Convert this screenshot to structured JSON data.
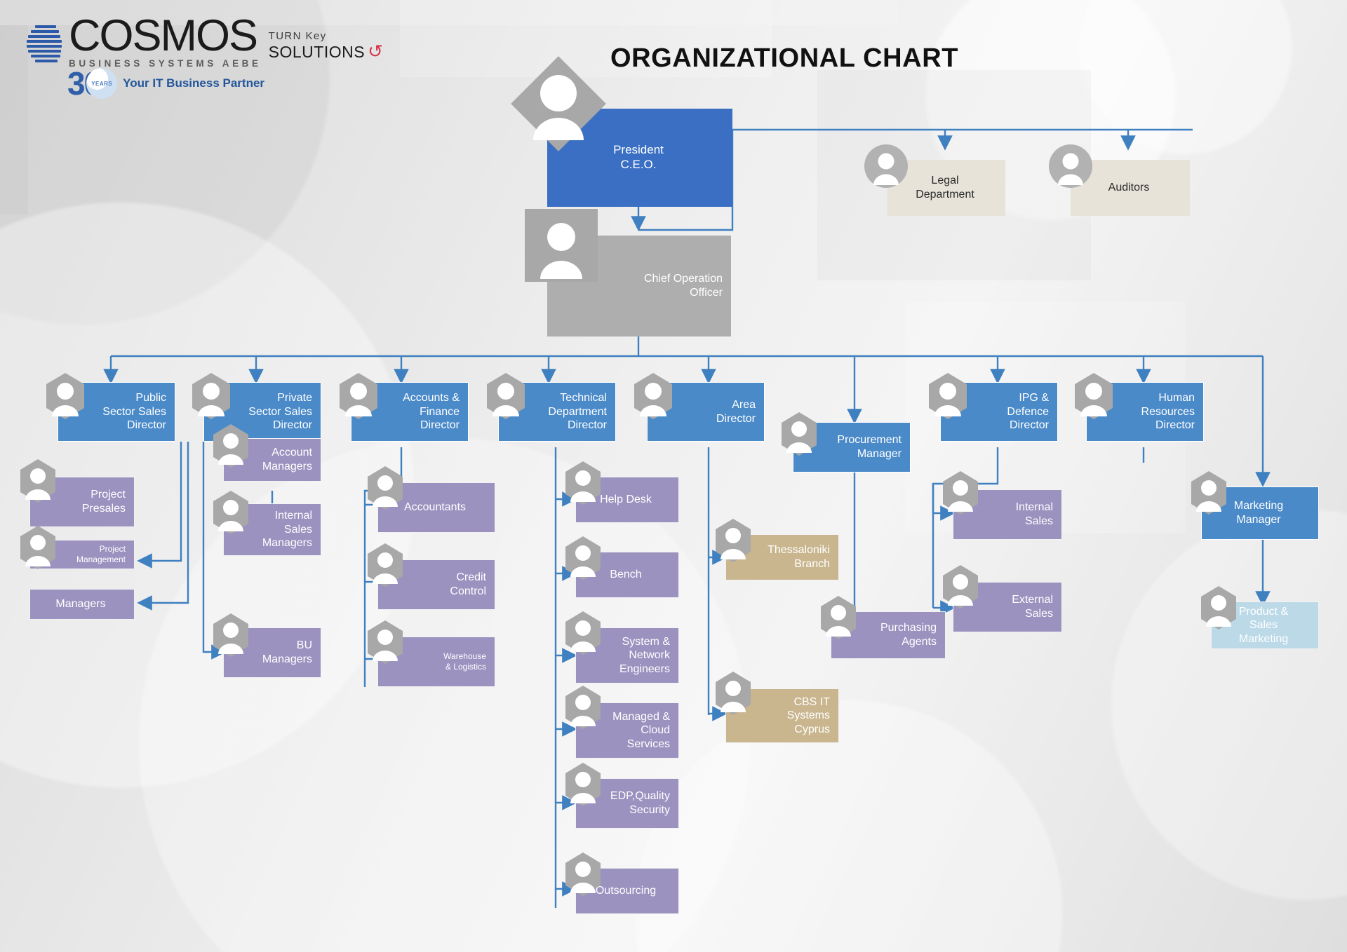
{
  "brand": {
    "name": "COSMOS",
    "tagline": "BUSINESS SYSTEMS AEBE",
    "turnkey_line1": "TURN Key",
    "turnkey_line2": "SOLUTIONS",
    "anniversary_number": "30",
    "anniversary_label": "YEARS",
    "partner_slogan": "Your IT Business Partner",
    "accent_blue": "#2f5fa8",
    "accent_red": "#d5344a"
  },
  "title": "ORGANIZATIONAL CHART",
  "palette": {
    "ceo_blue": "#3a6fc4",
    "director_blue": "#4a8ac9",
    "coo_grey": "#aeaeae",
    "advisory_beige": "#e7e3d9",
    "team_purple": "#9b92bf",
    "branch_tan": "#c9b68f",
    "marketing_light": "#bcd9e8",
    "connector": "#3f80c0"
  },
  "nodes": {
    "ceo": "President\nC.E.O.",
    "legal": "Legal\nDepartment",
    "auditors": "Auditors",
    "coo": "Chief Operation\nOfficer",
    "public_sector": "Public\nSector  Sales\nDirector",
    "project_presales": "Project\nPresales",
    "project_management": "Project\nManagement",
    "managers": "Managers",
    "private_sector": "Private\nSector Sales\nDirector",
    "account_managers": "Account\nManagers",
    "internal_sales_managers": "Internal\nSales\nManagers",
    "bu_managers": "BU\nManagers",
    "accounts_finance": "Accounts &\nFinance\nDirector",
    "accountants": "Accountants",
    "credit_control": "Credit\nControl",
    "warehouse_logistics": "Warehouse\n& Logistics",
    "technical_dept": "Technical\nDepartment\nDirector",
    "help_desk": "Help Desk",
    "bench": "Bench",
    "system_network": "System &\nNetwork\nEngineers",
    "managed_cloud": "Managed &\nCloud\nServices",
    "edp_quality": "EDP,Quality\nSecurity",
    "outsourcing": "Outsourcing",
    "area_director": "Area\nDirector",
    "thessaloniki": "Thessaloniki\nBranch",
    "cbs_cyprus": "CBS IT\nSystems\nCyprus",
    "procurement": "Procurement\nManager",
    "purchasing_agents": "Purchasing\nAgents",
    "ipg_defence": "IPG &\nDefence\nDirector",
    "internal_sales": "Internal\nSales",
    "external_sales": "External\nSales",
    "human_resources": "Human\nResources\nDirector",
    "marketing_manager": "Marketing\nManager",
    "product_sales_marketing": "Product &\nSales\nMarketing"
  },
  "icons": {
    "person_hex": "person-hexagon-icon",
    "person_circle": "person-circle-icon",
    "person_diamond": "person-diamond-icon",
    "person_square": "person-square-icon"
  }
}
